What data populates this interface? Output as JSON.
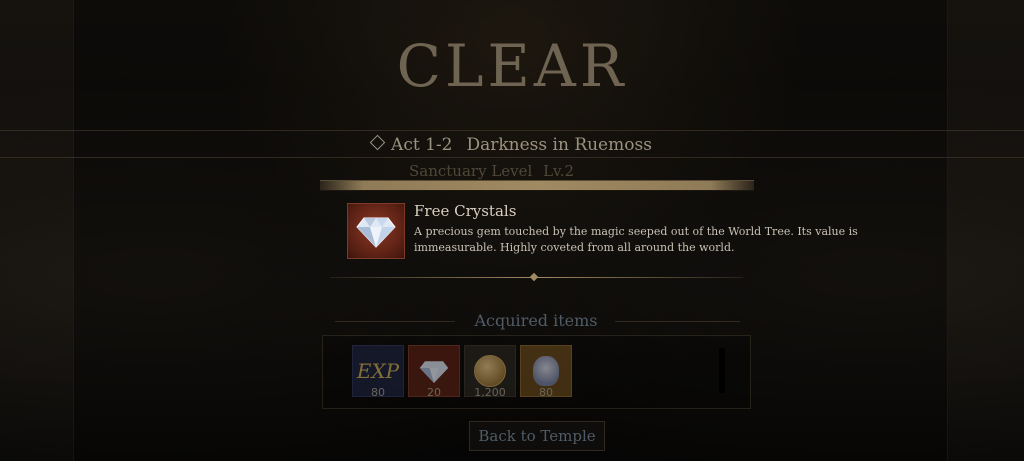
{
  "result": {
    "title": "CLEAR"
  },
  "stage": {
    "act": "Act 1-2",
    "name": "Darkness in Ruemoss"
  },
  "sanctuary": {
    "label": "Sanctuary Level",
    "level": "Lv.2"
  },
  "featured_item": {
    "name": "Free Crystals",
    "description": "A precious gem touched by the magic seeped out of the World Tree. Its value is immeasurable. Highly coveted from all around the world.",
    "icon": "crystal-gem-icon"
  },
  "acquired": {
    "title": "Acquired items",
    "items": [
      {
        "icon": "exp-icon",
        "label": "EXP",
        "qty": "80"
      },
      {
        "icon": "crystal-gem-icon",
        "qty": "20"
      },
      {
        "icon": "gold-coin-icon",
        "qty": "1,200"
      },
      {
        "icon": "character-portrait-icon",
        "qty": "80"
      }
    ]
  },
  "buttons": {
    "back": "Back to Temple"
  },
  "colors": {
    "accent": "#a08a62",
    "item_bg": "#8d3a26"
  }
}
